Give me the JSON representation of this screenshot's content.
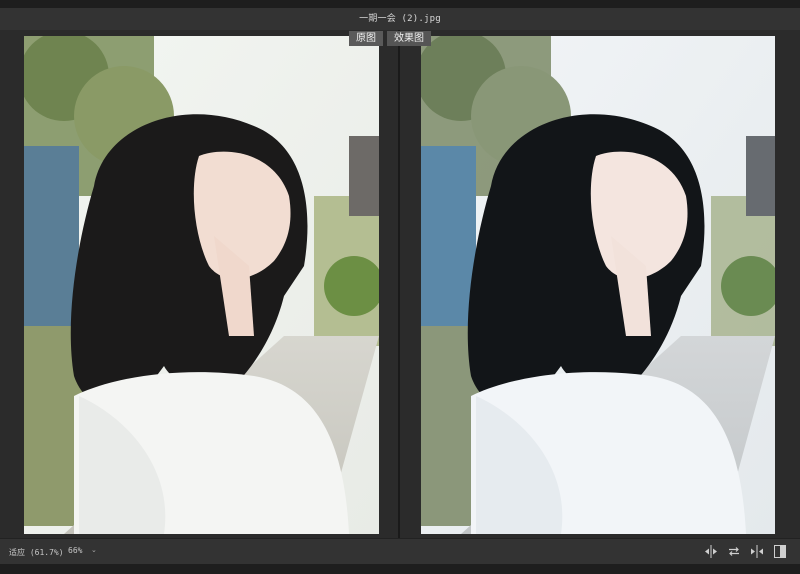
{
  "window": {
    "title": "一期一会 (2).jpg"
  },
  "compare": {
    "original_label": "原图",
    "result_label": "效果图"
  },
  "status": {
    "fit_label": "适应 (61.7%)",
    "zoom_value": "66%"
  },
  "toolbar": {
    "icons": [
      "split-vertical-icon",
      "swap-icon",
      "split-horizontal-icon",
      "single-view-icon"
    ]
  },
  "colors": {
    "background": "#282828",
    "chrome": "#333333",
    "label_bg": "#5a5a5a"
  }
}
